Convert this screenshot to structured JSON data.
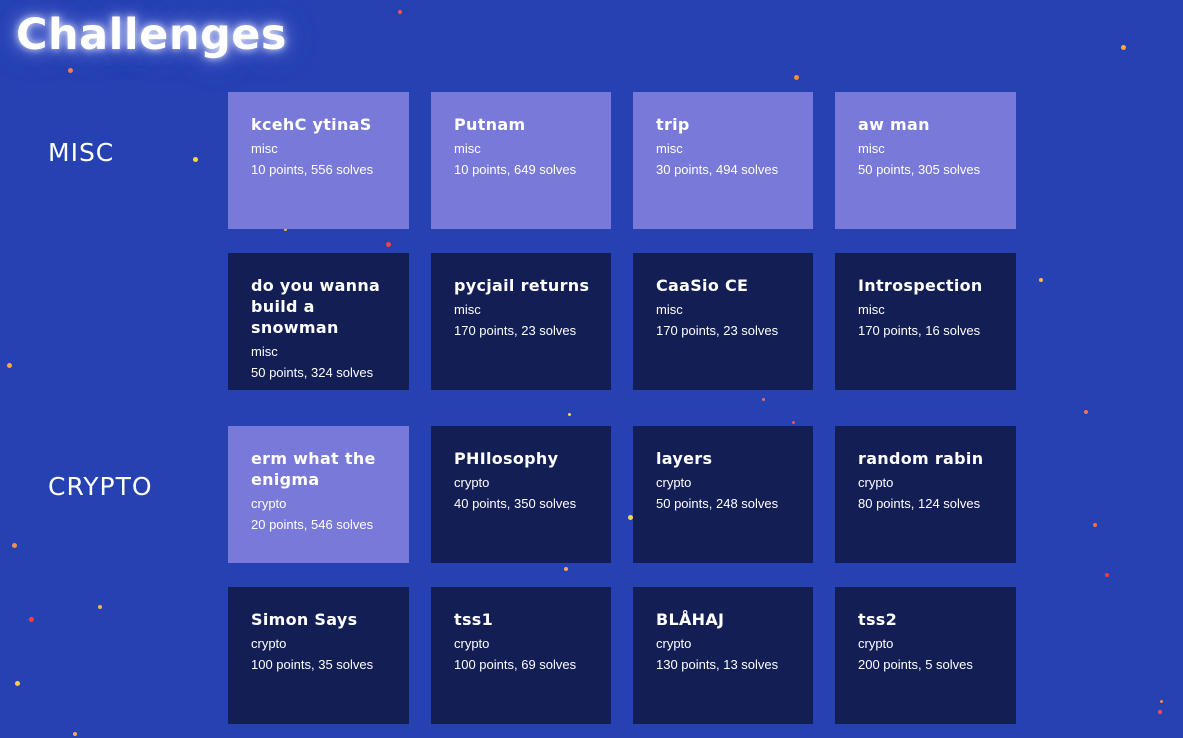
{
  "page_title": "Challenges",
  "colors": {
    "background": "#2541b2",
    "card_solved": "#7879d8",
    "card_unsolved": "#131e55",
    "text": "#ffffff"
  },
  "categories": [
    {
      "label": "MISC",
      "challenges": [
        {
          "name": "kcehC ytinaS",
          "category": "misc",
          "stats": "10 points, 556 solves",
          "solved": true
        },
        {
          "name": "Putnam",
          "category": "misc",
          "stats": "10 points, 649 solves",
          "solved": true
        },
        {
          "name": "trip",
          "category": "misc",
          "stats": "30 points, 494 solves",
          "solved": true
        },
        {
          "name": "aw man",
          "category": "misc",
          "stats": "50 points, 305 solves",
          "solved": true
        },
        {
          "name": "do you wanna build a snowman",
          "category": "misc",
          "stats": "50 points, 324 solves",
          "solved": false
        },
        {
          "name": "pycjail returns",
          "category": "misc",
          "stats": "170 points, 23 solves",
          "solved": false
        },
        {
          "name": "CaaSio CE",
          "category": "misc",
          "stats": "170 points, 23 solves",
          "solved": false
        },
        {
          "name": "Introspection",
          "category": "misc",
          "stats": "170 points, 16 solves",
          "solved": false
        }
      ]
    },
    {
      "label": "CRYPTO",
      "challenges": [
        {
          "name": "erm what the enigma",
          "category": "crypto",
          "stats": "20 points, 546 solves",
          "solved": true
        },
        {
          "name": "PHIlosophy",
          "category": "crypto",
          "stats": "40 points, 350 solves",
          "solved": false
        },
        {
          "name": "layers",
          "category": "crypto",
          "stats": "50 points, 248 solves",
          "solved": false
        },
        {
          "name": "random rabin",
          "category": "crypto",
          "stats": "80 points, 124 solves",
          "solved": false
        },
        {
          "name": "Simon Says",
          "category": "crypto",
          "stats": "100 points, 35 solves",
          "solved": false
        },
        {
          "name": "tss1",
          "category": "crypto",
          "stats": "100 points, 69 solves",
          "solved": false
        },
        {
          "name": "BLÅHAJ",
          "category": "crypto",
          "stats": "130 points, 13 solves",
          "solved": false
        },
        {
          "name": "tss2",
          "category": "crypto",
          "stats": "200 points, 5 solves",
          "solved": false
        }
      ]
    }
  ]
}
